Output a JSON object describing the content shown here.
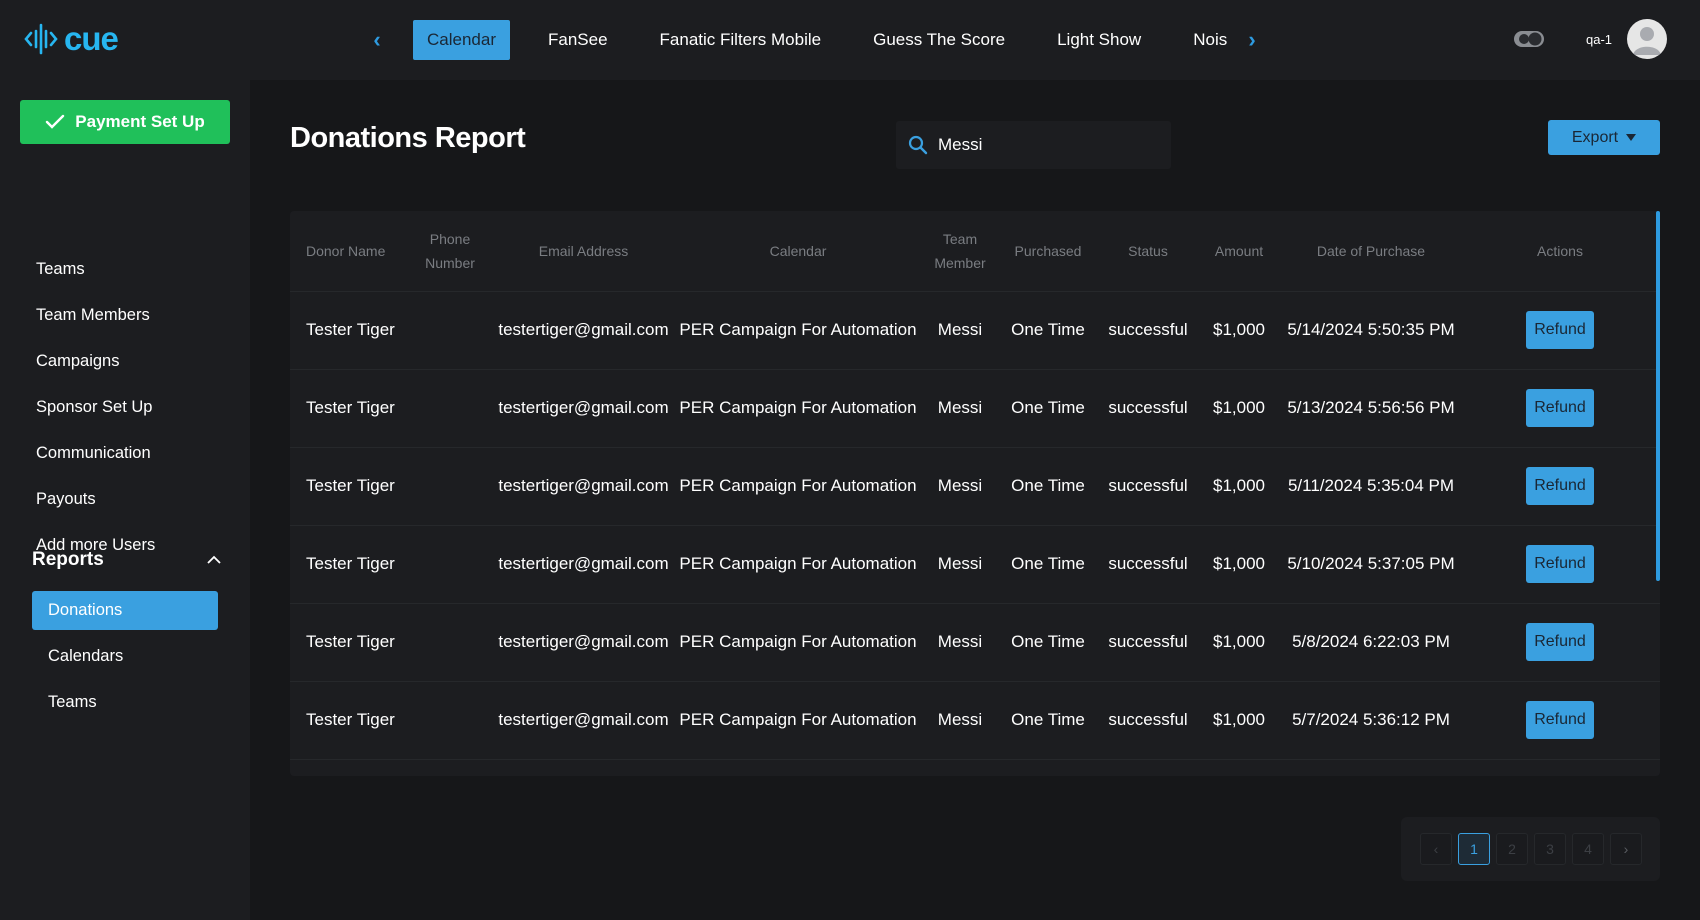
{
  "app": {
    "logo_text": "cue",
    "user": "qa-1"
  },
  "top_tabs": [
    "Calendar",
    "FanSee",
    "Fanatic Filters Mobile",
    "Guess The Score",
    "Light Show",
    "Noise"
  ],
  "active_tab": "Calendar",
  "sidebar": {
    "payment_button": "Payment Set Up",
    "items": [
      "Teams",
      "Team Members",
      "Campaigns",
      "Sponsor Set Up",
      "Communication",
      "Payouts",
      "Add more Users"
    ],
    "reports_label": "Reports",
    "report_items": [
      "Donations",
      "Calendars",
      "Teams"
    ]
  },
  "main": {
    "title": "Donations Report",
    "search_value": "Messi",
    "export_label": "Export"
  },
  "table": {
    "headers": [
      "Donor Name",
      "Phone Number",
      "Email Address",
      "Calendar",
      "Team Member",
      "Purchased",
      "Status",
      "Amount",
      "Date of Purchase",
      "Actions"
    ],
    "action_label": "Refund",
    "rows": [
      {
        "donor": "Tester Tiger",
        "phone": "",
        "email": "testertiger@gmail.com",
        "calendar": "PER Campaign For Automation",
        "member": "Messi",
        "purchased": "One Time",
        "status": "successful",
        "amount": "$1,000",
        "date": "5/14/2024 5:50:35 PM"
      },
      {
        "donor": "Tester Tiger",
        "phone": "",
        "email": "testertiger@gmail.com",
        "calendar": "PER Campaign For Automation",
        "member": "Messi",
        "purchased": "One Time",
        "status": "successful",
        "amount": "$1,000",
        "date": "5/13/2024 5:56:56 PM"
      },
      {
        "donor": "Tester Tiger",
        "phone": "",
        "email": "testertiger@gmail.com",
        "calendar": "PER Campaign For Automation",
        "member": "Messi",
        "purchased": "One Time",
        "status": "successful",
        "amount": "$1,000",
        "date": "5/11/2024 5:35:04 PM"
      },
      {
        "donor": "Tester Tiger",
        "phone": "",
        "email": "testertiger@gmail.com",
        "calendar": "PER Campaign For Automation",
        "member": "Messi",
        "purchased": "One Time",
        "status": "successful",
        "amount": "$1,000",
        "date": "5/10/2024 5:37:05 PM"
      },
      {
        "donor": "Tester Tiger",
        "phone": "",
        "email": "testertiger@gmail.com",
        "calendar": "PER Campaign For Automation",
        "member": "Messi",
        "purchased": "One Time",
        "status": "successful",
        "amount": "$1,000",
        "date": "5/8/2024 6:22:03 PM"
      },
      {
        "donor": "Tester Tiger",
        "phone": "",
        "email": "testertiger@gmail.com",
        "calendar": "PER Campaign For Automation",
        "member": "Messi",
        "purchased": "One Time",
        "status": "successful",
        "amount": "$1,000",
        "date": "5/7/2024 5:36:12 PM"
      }
    ]
  },
  "pagination": {
    "pages": [
      "1",
      "2",
      "3",
      "4"
    ],
    "current": "1"
  },
  "colors": {
    "accent": "#3aa0e0",
    "success": "#20c05a",
    "background": "#161719",
    "panel": "#1c1d20"
  },
  "icons": [
    "logo-wave-icon",
    "chevron-left-icon",
    "chevron-right-icon",
    "theme-toggle-icon",
    "user-avatar-icon",
    "check-icon",
    "chevron-up-icon",
    "search-icon",
    "caret-down-icon"
  ]
}
